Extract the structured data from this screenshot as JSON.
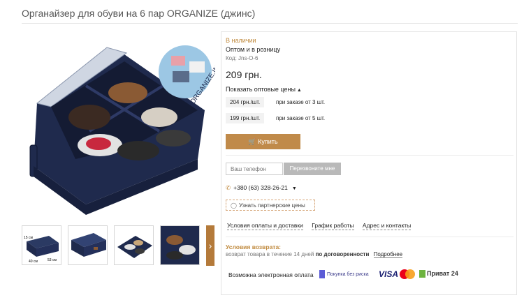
{
  "product": {
    "title": "Органайзер для обуви на 6 пар ORGANIZE (джинс)",
    "watermark": "ORGANIZE.IN.UA"
  },
  "thumbnails": [
    {
      "name": "thumb-dimensions",
      "labels": [
        "15 см",
        "40 см",
        "53 см"
      ]
    },
    {
      "name": "thumb-closed"
    },
    {
      "name": "thumb-open-shoes"
    },
    {
      "name": "thumb-shoes-closeup"
    }
  ],
  "info": {
    "stock": "В наличии",
    "wholesale": "Оптом и в розницу",
    "code": "Код: Jns-O-6",
    "price": "209 грн.",
    "show_wholesale": "Показать оптовые цены",
    "tiers": [
      {
        "price": "204 грн./шт.",
        "condition": "при заказе от 3 шт."
      },
      {
        "price": "199 грн./шт.",
        "condition": "при заказе от 5 шт."
      }
    ],
    "buy_label": "Купить",
    "phone_placeholder": "Ваш телефон",
    "callback_label": "Перезвоните мне",
    "phone": "+380 (63) 328-26-21",
    "partner_label": "Узнать партнерские цены",
    "links": [
      "Условия оплаты и доставки",
      "График работы",
      "Адрес и контакты"
    ],
    "return_title": "Условия возврата:",
    "return_text": "возврат товара в течение 14 дней",
    "return_bold": "по договоренности",
    "return_more": "Подробнее",
    "pay_label": "Возможна электронная оплата",
    "pay_later": "Покупка без риска",
    "visa": "VISA",
    "privat": "Приват 24"
  },
  "colors": {
    "accent": "#c08a4a",
    "stock": "#c08a3e",
    "organizer": "#1f2a4d"
  }
}
